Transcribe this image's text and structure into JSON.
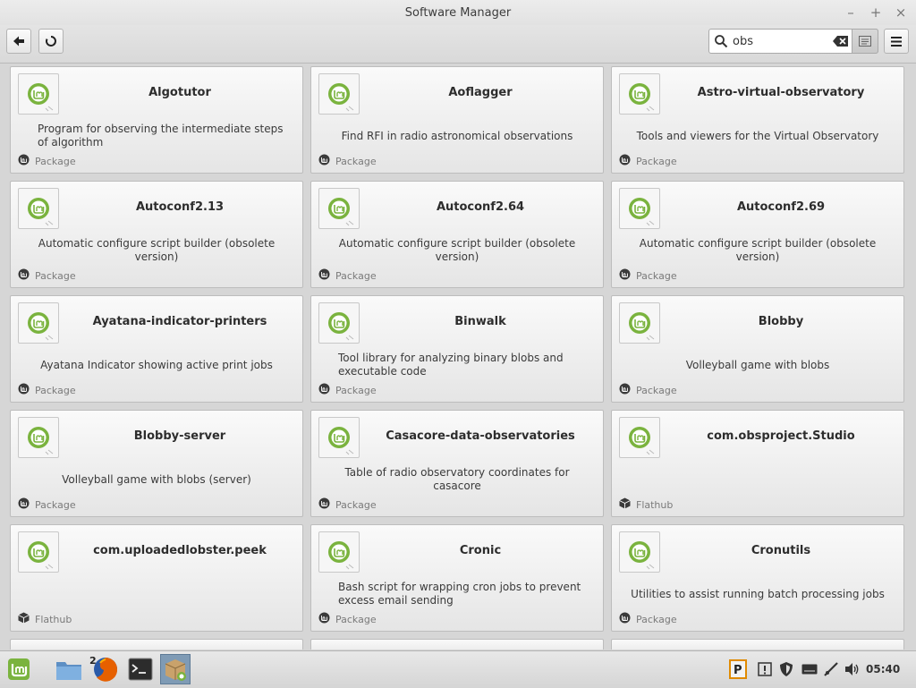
{
  "window": {
    "title": "Software Manager",
    "controls": [
      "minimize",
      "maximize",
      "close"
    ]
  },
  "toolbar": {
    "back_icon": "back-arrow-icon",
    "refresh_icon": "refresh-icon",
    "search": {
      "value": "obs",
      "placeholder": ""
    },
    "menu_icon": "hamburger-menu-icon"
  },
  "colors": {
    "accent": "#7ab33e",
    "card_bg": "#f4f4f4",
    "toolbar_bg": "#dedede",
    "taskbar_bg": "#e0e0e0"
  },
  "cards": [
    {
      "name": "Algotutor",
      "summary": "Program for observing the intermediate steps of algorithm",
      "origin": "Package"
    },
    {
      "name": "Aoflagger",
      "summary": "Find RFI in radio astronomical observations",
      "origin": "Package"
    },
    {
      "name": "Astro-virtual-observatory",
      "summary": "Tools and viewers for the Virtual Observatory",
      "origin": "Package"
    },
    {
      "name": "Autoconf2.13",
      "summary": "Automatic configure script builder (obsolete version)",
      "origin": "Package"
    },
    {
      "name": "Autoconf2.64",
      "summary": "Automatic configure script builder (obsolete version)",
      "origin": "Package"
    },
    {
      "name": "Autoconf2.69",
      "summary": "Automatic configure script builder (obsolete version)",
      "origin": "Package"
    },
    {
      "name": "Ayatana-indicator-printers",
      "summary": "Ayatana Indicator showing active print jobs",
      "origin": "Package"
    },
    {
      "name": "Binwalk",
      "summary": "Tool library for analyzing binary blobs and executable code",
      "origin": "Package"
    },
    {
      "name": "Blobby",
      "summary": "Volleyball game with blobs",
      "origin": "Package"
    },
    {
      "name": "Blobby-server",
      "summary": "Volleyball game with blobs (server)",
      "origin": "Package"
    },
    {
      "name": "Casacore-data-observatories",
      "summary": "Table of radio observatory coordinates for casacore",
      "origin": "Package"
    },
    {
      "name": "com.obsproject.Studio",
      "summary": "",
      "origin": "Flathub"
    },
    {
      "name": "com.uploadedlobster.peek",
      "summary": "",
      "origin": "Flathub"
    },
    {
      "name": "Cronic",
      "summary": "Bash script for wrapping cron jobs to prevent excess email sending",
      "origin": "Package"
    },
    {
      "name": "Cronutils",
      "summary": "Utilities to assist running batch processing jobs",
      "origin": "Package"
    }
  ],
  "taskbar": {
    "menu_icon": "linux-mint-menu-icon",
    "apps": [
      {
        "name": "files-icon"
      },
      {
        "name": "firefox-icon",
        "badge": "2"
      },
      {
        "name": "terminal-icon"
      },
      {
        "name": "software-manager-icon"
      }
    ],
    "tray": [
      "parcellite-icon",
      "update-notifier-icon",
      "shield-icon",
      "keyboard-icon",
      "network-icon",
      "volume-icon"
    ],
    "clock": "05:40"
  }
}
